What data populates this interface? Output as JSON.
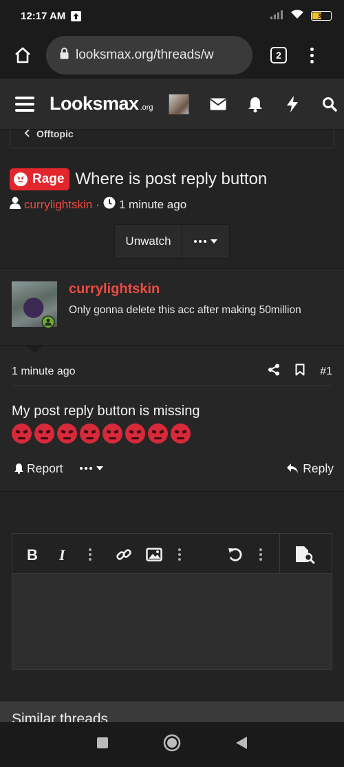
{
  "status_bar": {
    "time": "12:17 AM",
    "battery": "30"
  },
  "browser": {
    "url": "looksmax.org/threads/w",
    "tab_count": "2"
  },
  "site": {
    "logo_main": "Looksmax",
    "logo_suffix": ".org"
  },
  "breadcrumb": {
    "label": "Offtopic"
  },
  "thread": {
    "prefix": "Rage",
    "title": "Where is post reply button",
    "author": "currylightskin",
    "separator": "·",
    "time": "1 minute ago",
    "unwatch_label": "Unwatch"
  },
  "post": {
    "username": "currylightskin",
    "user_title": "Only gonna delete this acc after making 50million",
    "date": "1 minute ago",
    "number": "#1",
    "body": "My post reply button is missing",
    "emoji_count": 8,
    "report_label": "Report",
    "reply_label": "Reply"
  },
  "similar": {
    "heading": "Similar threads"
  },
  "colors": {
    "accent": "#ef4a42",
    "prefix_red": "#e3262d",
    "background": "#232323"
  },
  "icons": [
    "home-icon",
    "lock-icon",
    "menu-icon",
    "hamburger-icon",
    "envelope-icon",
    "bell-icon",
    "bolt-icon",
    "search-icon",
    "user-icon",
    "clock-icon",
    "share-icon",
    "bookmark-icon",
    "report-bell-icon",
    "reply-icon",
    "bold-icon",
    "italic-icon",
    "link-icon",
    "image-icon",
    "undo-icon",
    "preview-icon"
  ]
}
